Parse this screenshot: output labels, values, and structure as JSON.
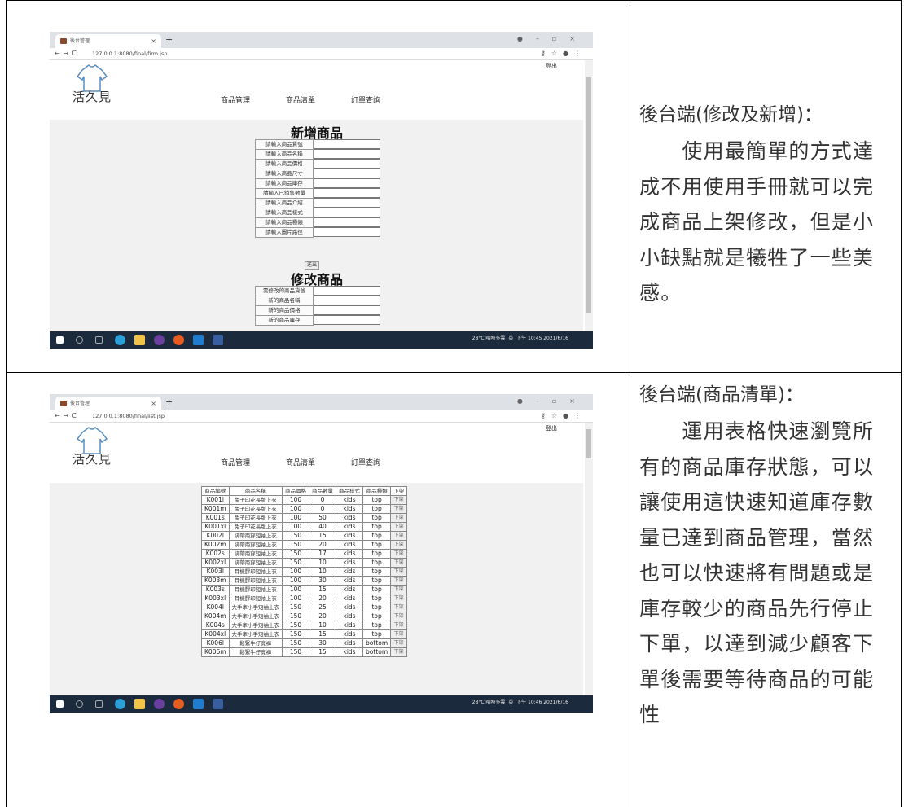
{
  "rows": [
    {
      "title": "後台端(修改及新增)：",
      "body": "　　使用最簡單的方式達成不用使用手冊就可以完成商品上架修改，但是小小缺點就是犧牲了一些美感。",
      "browser": {
        "tab_title": "後台管理",
        "url": "127.0.0.1:8080/final/firm.jsp",
        "logout": "登出",
        "logo": "活久見",
        "menu": [
          "商品管理",
          "商品清單",
          "訂單查詢"
        ],
        "add_title": "新增商品",
        "add_fields": [
          "請輸入商品貨號",
          "請輸入商品名稱",
          "請輸入商品價格",
          "請輸入商品尺寸",
          "請輸入商品庫存",
          "請輸入已銷售數量",
          "請輸入商品介紹",
          "請輸入商品樣式",
          "請輸入商品種類",
          "請輸入圖片路徑"
        ],
        "submit": "送出",
        "edit_title": "修改商品",
        "edit_fields": [
          "需修改的商品貨號",
          "新的商品名稱",
          "新的商品價格",
          "新的商品庫存"
        ],
        "taskbar_status": "28°C 晴時多雲",
        "ime": "英",
        "time": "下午 10:45",
        "date": "2021/6/16"
      }
    },
    {
      "title": "後台端(商品清單)：",
      "body": "　　運用表格快速瀏覽所有的商品庫存狀態，可以讓使用這快速知道庫存數量已達到商品管理，當然也可以快速將有問題或是庫存較少的商品先行停止下單，以達到減少顧客下單後需要等待商品的可能性",
      "browser": {
        "tab_title": "後台管理",
        "url": "127.0.0.1:8080/final/list.jsp",
        "logout": "登出",
        "logo": "活久見",
        "menu": [
          "商品管理",
          "商品清單",
          "訂單查詢"
        ],
        "table_headers": [
          "商品編號",
          "商品名稱",
          "商品價格",
          "商品數量",
          "商品樣式",
          "商品種類",
          "下架"
        ],
        "table_rows": [
          [
            "K001l",
            "兔子印花長版上衣",
            "100",
            "0",
            "kids",
            "top"
          ],
          [
            "K001m",
            "兔子印花長版上衣",
            "100",
            "0",
            "kids",
            "top"
          ],
          [
            "K001s",
            "兔子印花長版上衣",
            "100",
            "50",
            "kids",
            "top"
          ],
          [
            "K001xl",
            "兔子印花長版上衣",
            "100",
            "40",
            "kids",
            "top"
          ],
          [
            "K002l",
            "綁帶兩穿短袖上衣",
            "150",
            "15",
            "kids",
            "top"
          ],
          [
            "K002m",
            "綁帶兩穿短袖上衣",
            "150",
            "20",
            "kids",
            "top"
          ],
          [
            "K002s",
            "綁帶兩穿短袖上衣",
            "150",
            "17",
            "kids",
            "top"
          ],
          [
            "K002xl",
            "綁帶兩穿短袖上衣",
            "150",
            "10",
            "kids",
            "top"
          ],
          [
            "K003l",
            "耳機膠印短袖上衣",
            "100",
            "10",
            "kids",
            "top"
          ],
          [
            "K003m",
            "耳機膠印短袖上衣",
            "100",
            "30",
            "kids",
            "top"
          ],
          [
            "K003s",
            "耳機膠印短袖上衣",
            "100",
            "15",
            "kids",
            "top"
          ],
          [
            "K003xl",
            "耳機膠印短袖上衣",
            "100",
            "20",
            "kids",
            "top"
          ],
          [
            "K004l",
            "大手牽小手短袖上衣",
            "150",
            "25",
            "kids",
            "top"
          ],
          [
            "K004m",
            "大手牽小手短袖上衣",
            "150",
            "20",
            "kids",
            "top"
          ],
          [
            "K004s",
            "大手牽小手短袖上衣",
            "150",
            "10",
            "kids",
            "top"
          ],
          [
            "K004xl",
            "大手牽小手短袖上衣",
            "150",
            "15",
            "kids",
            "top"
          ],
          [
            "K006l",
            "鬆緊牛仔寬褲",
            "150",
            "30",
            "kids",
            "bottom"
          ],
          [
            "K006m",
            "鬆緊牛仔寬褲",
            "150",
            "15",
            "kids",
            "bottom"
          ]
        ],
        "delist_label": "下架",
        "taskbar_status": "28°C 晴時多雲",
        "ime": "英",
        "time": "下午 10:46",
        "date": "2021/6/16"
      }
    }
  ]
}
